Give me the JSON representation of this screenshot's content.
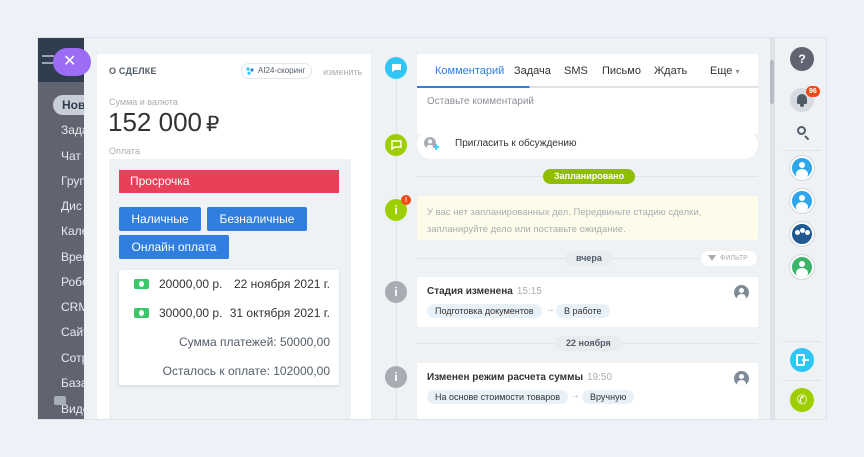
{
  "sidebar": {
    "items": [
      {
        "label": "Нов"
      },
      {
        "label": "Зада"
      },
      {
        "label": "Чат"
      },
      {
        "label": "Груп"
      },
      {
        "label": "Дис"
      },
      {
        "label": "Кале"
      },
      {
        "label": "Врем"
      },
      {
        "label": "Робо"
      },
      {
        "label": "CRM"
      },
      {
        "label": "Сайт"
      },
      {
        "label": "Сотр"
      },
      {
        "label": "База"
      },
      {
        "label": "Виде"
      }
    ],
    "close_symbol": "✕"
  },
  "deal": {
    "title": "О СДЕЛКЕ",
    "ai_badge": "AI24-скоринг",
    "change_link": "изменить",
    "sum_label": "Сумма и валюта",
    "amount": "152 000",
    "currency": "₽",
    "payment_label": "Оплата",
    "overdue": "Просрочка",
    "buttons": {
      "cash": "Наличные",
      "cashless": "Безналичные",
      "online": "Онлайн оплата"
    },
    "payments": [
      {
        "amount": "20000,00 р.",
        "date": "22 ноября 2021 г."
      },
      {
        "amount": "30000,00 р.",
        "date": "31 октября 2021 г."
      }
    ],
    "total_payments": "Сумма платежей: 50000,00",
    "remaining": "Осталось к оплате: 102000,00"
  },
  "timeline": {
    "tabs": [
      {
        "label": "Комментарий"
      },
      {
        "label": "Задача"
      },
      {
        "label": "SMS"
      },
      {
        "label": "Письмо"
      },
      {
        "label": "Ждать"
      },
      {
        "label": "Еще"
      }
    ],
    "more_caret": "▾",
    "comment_placeholder": "Оставьте комментарий",
    "invite_text": "Пригласить к обсуждению",
    "planned_label": "Запланировано",
    "planned_warning": "У вас нет запланированных дел. Передвиньте стадию сделки, запланируйте дело или поставьте ожидание.",
    "yesterday_label": "вчера",
    "filter_label": "ФИЛЬТР",
    "nov22_label": "22 ноября",
    "events": [
      {
        "title": "Стадия изменена",
        "time": "15:15",
        "from": "Подготовка документов",
        "to": "В работе"
      },
      {
        "title": "Изменен режим расчета суммы",
        "time": "19:50",
        "from": "На основе стоимости товаров",
        "to": "Вручную"
      }
    ],
    "arrow": "→",
    "info_symbol": "i",
    "warn_badge": "!"
  },
  "right_panel": {
    "help_symbol": "?",
    "notification_count": "96",
    "phone_symbol": "✆"
  },
  "colors": {
    "accent_blue": "#2f7ee0",
    "overdue_red": "#e9405a",
    "planned_green": "#8fbe00",
    "timeline_blue": "#2fc6f6"
  }
}
